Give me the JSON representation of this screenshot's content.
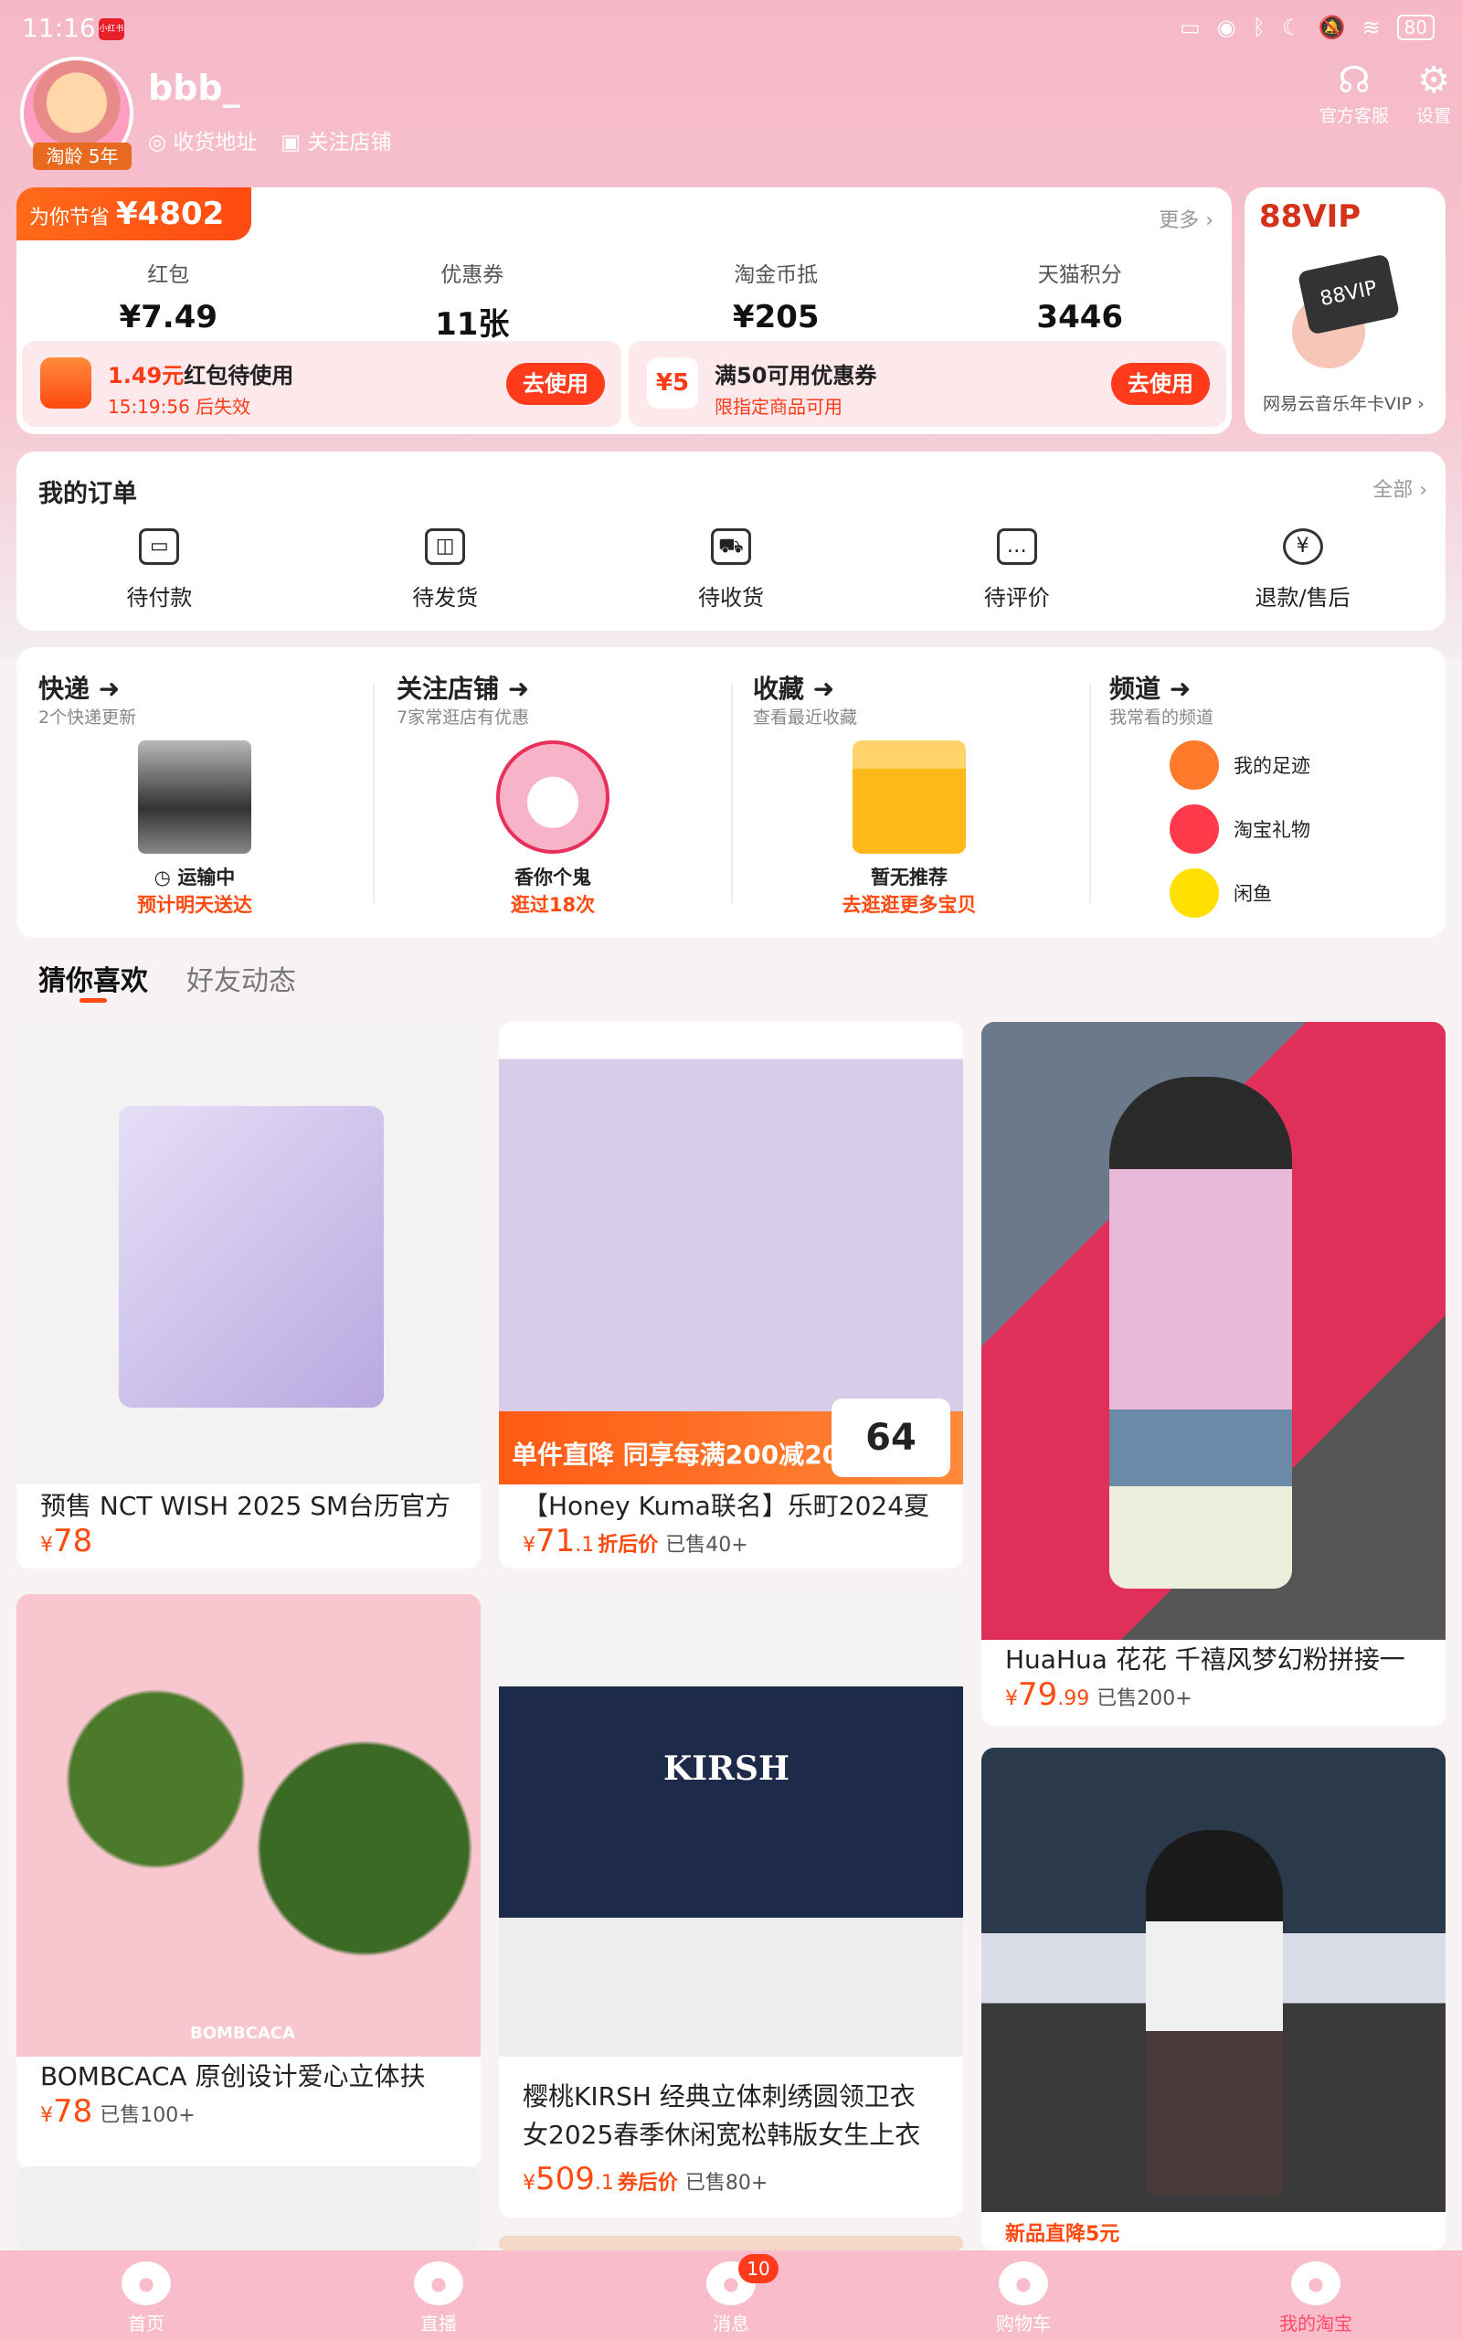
{
  "status_bar": {
    "time": "11:16",
    "app_badge": "小红书",
    "battery": "80"
  },
  "profile": {
    "username": "bbb_",
    "taoling": "淘龄 5年",
    "address_link": "收货地址",
    "follow_link": "关注店铺",
    "service_label": "官方客服",
    "settings_label": "设置"
  },
  "savings": {
    "prefix": "为你节省",
    "amount": "¥4802",
    "more": "更多 ›",
    "stats": [
      {
        "label": "红包",
        "value": "¥7.49"
      },
      {
        "label": "优惠券",
        "value": "11张"
      },
      {
        "label": "淘金币抵",
        "value": "¥205"
      },
      {
        "label": "天猫积分",
        "value": "3446"
      }
    ],
    "coupons": [
      {
        "amount": "1.49元",
        "title": "红包待使用",
        "sub": "15:19:56 后失效",
        "btn": "去使用",
        "badge": ""
      },
      {
        "amount": "",
        "title": "满50可用优惠券",
        "sub": "限指定商品可用",
        "btn": "去使用",
        "badge": "¥5"
      }
    ]
  },
  "vip": {
    "title": "88VIP",
    "card_label": "88VIP",
    "sub": "网易云音乐年卡VIP ›"
  },
  "orders": {
    "title": "我的订单",
    "all": "全部 ›",
    "items": [
      {
        "label": "待付款",
        "icon": "wallet-icon"
      },
      {
        "label": "待发货",
        "icon": "package-icon"
      },
      {
        "label": "待收货",
        "icon": "truck-icon"
      },
      {
        "label": "待评价",
        "icon": "comment-icon"
      },
      {
        "label": "退款/售后",
        "icon": "refund-icon"
      }
    ]
  },
  "quick": [
    {
      "title": "快递",
      "sub": "2个快递更新",
      "line1": "运输中",
      "line2": "预计明天送达"
    },
    {
      "title": "关注店铺",
      "sub": "7家常逛店有优惠",
      "line1": "香你个鬼",
      "line2": "逛过18次"
    },
    {
      "title": "收藏",
      "sub": "查看最近收藏",
      "line1": "暂无推荐",
      "line2": "去逛逛更多宝贝"
    },
    {
      "title": "频道",
      "sub": "我常看的频道"
    }
  ],
  "channels": [
    {
      "label": "我的足迹",
      "color": "#ff7a2a"
    },
    {
      "label": "淘宝礼物",
      "color": "#ff3a4a"
    },
    {
      "label": "闲鱼",
      "color": "#ffe000"
    }
  ],
  "feed_tabs": {
    "active": "猜你喜欢",
    "inactive": "好友动态"
  },
  "products": [
    {
      "title": "预售 NCT WISH 2025 SM台历官方",
      "price": "78",
      "price_small": "",
      "tag": "",
      "sold": ""
    },
    {
      "title": "【Honey Kuma联名】乐町2024夏",
      "price": "71",
      "price_small": ".1",
      "tag": "折后价",
      "sold": "已售40+",
      "banner": "单件直降 同享每满200减20",
      "banner_num": "64"
    },
    {
      "title": "HuaHua 花花 千禧风梦幻粉拼接一",
      "price": "79",
      "price_small": ".99",
      "tag": "",
      "sold": "已售200+"
    },
    {
      "title": "BOMBCACA 原创设计爱心立体扶",
      "price": "78",
      "price_small": "",
      "tag": "",
      "sold": "已售100+",
      "img_label": "BOMBCACA"
    },
    {
      "title1": "樱桃KIRSH 经典立体刺绣圆领卫衣",
      "title2": "女2025春季休闲宽松韩版女生上衣",
      "price": "509",
      "price_small": ".1",
      "tag": "券后价",
      "sold": "已售80+",
      "img_label": "KIRSH"
    },
    {
      "tag_line": "新品直降5元"
    }
  ],
  "nav": [
    {
      "label": "首页"
    },
    {
      "label": "直播"
    },
    {
      "label": "消息",
      "badge": "10"
    },
    {
      "label": "购物车"
    },
    {
      "label": "我的淘宝"
    }
  ]
}
